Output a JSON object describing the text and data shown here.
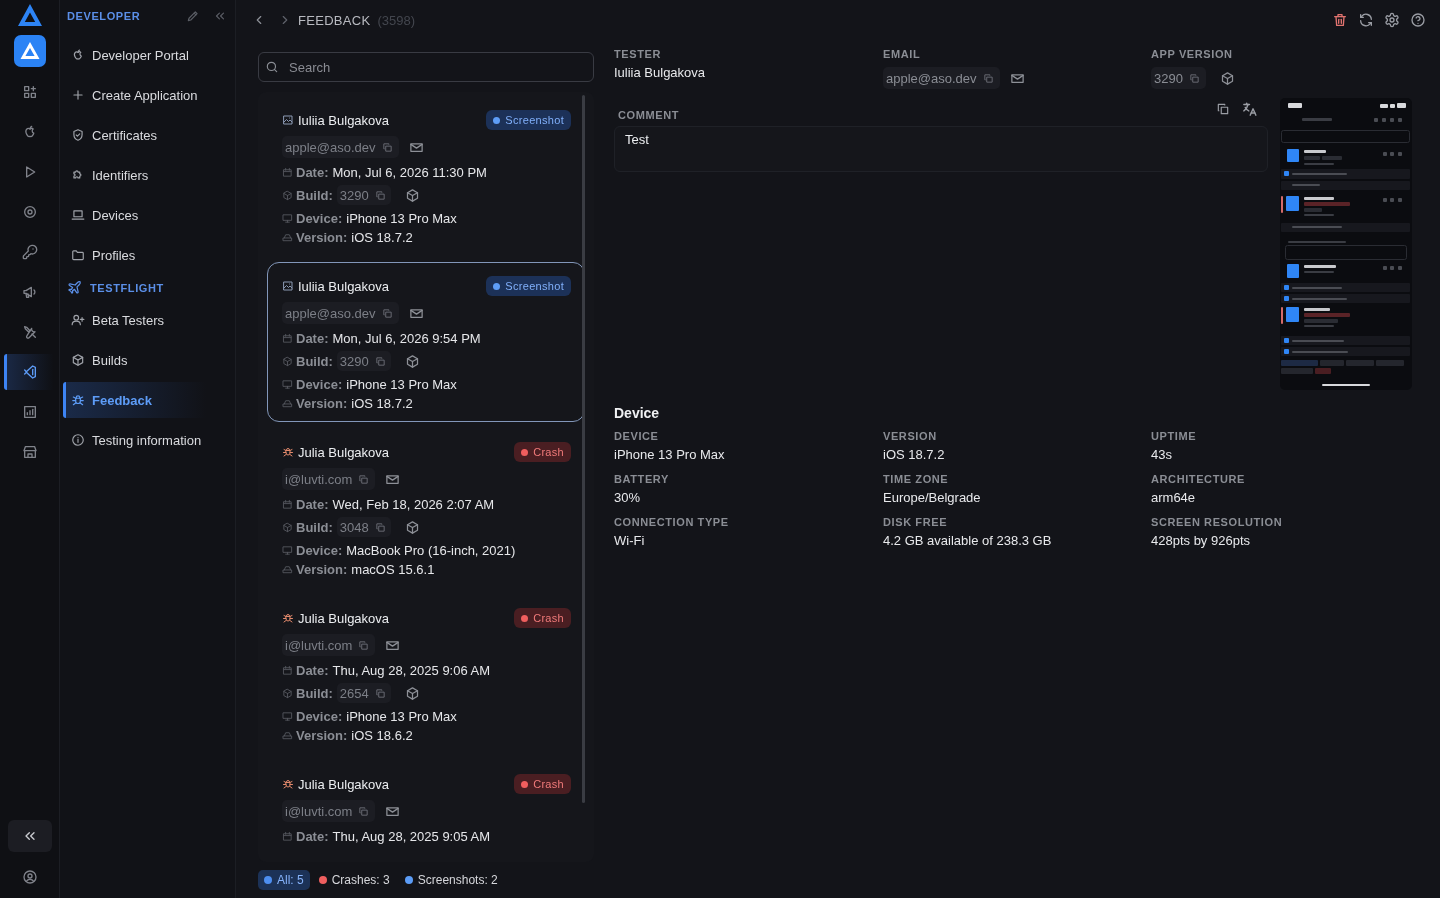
{
  "rail": {
    "items": [
      {
        "selected": false
      },
      {
        "selected": false
      },
      {
        "selected": false
      },
      {
        "selected": false
      },
      {
        "selected": false
      },
      {
        "selected": false
      },
      {
        "selected": false
      },
      {
        "selected": true
      },
      {
        "selected": false
      },
      {
        "selected": false
      }
    ]
  },
  "sidebar": {
    "sections": [
      {
        "title": "DEVELOPER",
        "items": [
          {
            "label": "Developer Portal",
            "selected": false
          },
          {
            "label": "Create Application",
            "selected": false
          },
          {
            "label": "Certificates",
            "selected": false
          },
          {
            "label": "Identifiers",
            "selected": false
          },
          {
            "label": "Devices",
            "selected": false
          },
          {
            "label": "Profiles",
            "selected": false
          }
        ]
      },
      {
        "title": "TESTFLIGHT",
        "items": [
          {
            "label": "Beta Testers",
            "selected": false
          },
          {
            "label": "Builds",
            "selected": false
          },
          {
            "label": "Feedback",
            "selected": true
          },
          {
            "label": "Testing information",
            "selected": false
          }
        ]
      }
    ]
  },
  "header": {
    "title": "FEEDBACK",
    "count": "(3598)"
  },
  "search": {
    "placeholder": "Search"
  },
  "feedback_list": [
    {
      "kind": "screenshot",
      "selected": false,
      "tester": "Iuliia Bulgakova",
      "badge": "Screenshot",
      "email": "apple@aso.dev",
      "date": {
        "label": "Date:",
        "value": "Mon, Jul 6, 2026 11:30 PM"
      },
      "build": {
        "label": "Build:",
        "value": "3290"
      },
      "device": {
        "label": "Device:",
        "value": "iPhone 13 Pro Max"
      },
      "version": {
        "label": "Version:",
        "value": "iOS 18.7.2"
      }
    },
    {
      "kind": "screenshot",
      "selected": true,
      "tester": "Iuliia Bulgakova",
      "badge": "Screenshot",
      "email": "apple@aso.dev",
      "date": {
        "label": "Date:",
        "value": "Mon, Jul 6, 2026 9:54 PM"
      },
      "build": {
        "label": "Build:",
        "value": "3290"
      },
      "device": {
        "label": "Device:",
        "value": "iPhone 13 Pro Max"
      },
      "version": {
        "label": "Version:",
        "value": "iOS 18.7.2"
      }
    },
    {
      "kind": "crash",
      "selected": false,
      "tester": "Julia Bulgakova",
      "badge": "Crash",
      "email": "i@luvti.com",
      "date": {
        "label": "Date:",
        "value": "Wed, Feb 18, 2026 2:07 AM"
      },
      "build": {
        "label": "Build:",
        "value": "3048"
      },
      "device": {
        "label": "Device:",
        "value": "MacBook Pro (16-inch, 2021)"
      },
      "version": {
        "label": "Version:",
        "value": "macOS 15.6.1"
      }
    },
    {
      "kind": "crash",
      "selected": false,
      "tester": "Julia Bulgakova",
      "badge": "Crash",
      "email": "i@luvti.com",
      "date": {
        "label": "Date:",
        "value": "Thu, Aug 28, 2025 9:06 AM"
      },
      "build": {
        "label": "Build:",
        "value": "2654"
      },
      "device": {
        "label": "Device:",
        "value": "iPhone 13 Pro Max"
      },
      "version": {
        "label": "Version:",
        "value": "iOS 18.6.2"
      }
    },
    {
      "kind": "crash",
      "selected": false,
      "tester": "Julia Bulgakova",
      "badge": "Crash",
      "email": "i@luvti.com",
      "date": {
        "label": "Date:",
        "value": "Thu, Aug 28, 2025 9:05 AM"
      }
    }
  ],
  "filters": [
    {
      "label": "All: 5",
      "color": "#4d8ef0",
      "selected": true
    },
    {
      "label": "Crashes: 3",
      "color": "#ef5f5f",
      "selected": false
    },
    {
      "label": "Screenshots: 2",
      "color": "#5b9cf6",
      "selected": false
    }
  ],
  "detail": {
    "tester": {
      "label": "TESTER",
      "value": "Iuliia Bulgakova"
    },
    "email": {
      "label": "EMAIL",
      "value": "apple@aso.dev"
    },
    "app_version": {
      "label": "APP VERSION",
      "value": "3290"
    },
    "comment": {
      "label": "COMMENT",
      "value": "Test"
    }
  },
  "device_info": {
    "title": "Device",
    "fields": [
      {
        "label": "DEVICE",
        "value": "iPhone 13 Pro Max"
      },
      {
        "label": "VERSION",
        "value": "iOS 18.7.2"
      },
      {
        "label": "UPTIME",
        "value": "43s"
      },
      {
        "label": "BATTERY",
        "value": "30%"
      },
      {
        "label": "TIME ZONE",
        "value": "Europe/Belgrade"
      },
      {
        "label": "ARCHITECTURE",
        "value": "arm64e"
      },
      {
        "label": "CONNECTION TYPE",
        "value": "Wi-Fi"
      },
      {
        "label": "DISK FREE",
        "value": "4.2 GB available of 238.3 GB"
      },
      {
        "label": "SCREEN RESOLUTION",
        "value": "428pts by 926pts"
      }
    ]
  }
}
